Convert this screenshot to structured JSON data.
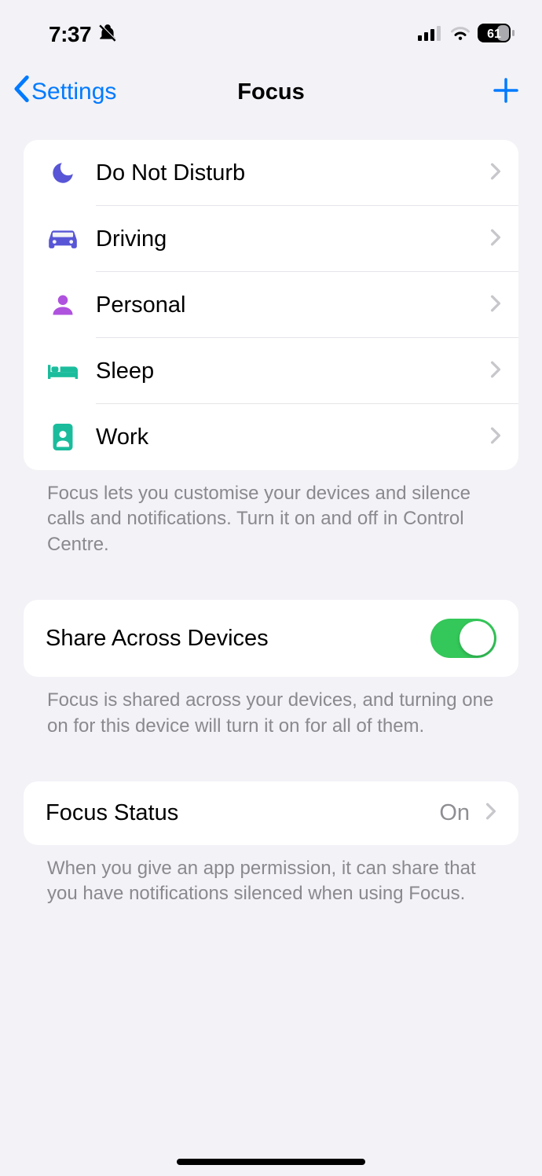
{
  "status": {
    "time": "7:37",
    "battery": "61"
  },
  "nav": {
    "back": "Settings",
    "title": "Focus"
  },
  "focusModes": [
    {
      "label": "Do Not Disturb",
      "icon": "moon",
      "color": "#5856d6"
    },
    {
      "label": "Driving",
      "icon": "car",
      "color": "#5856d6"
    },
    {
      "label": "Personal",
      "icon": "person",
      "color": "#af52de"
    },
    {
      "label": "Sleep",
      "icon": "bed",
      "color": "#1abc9c"
    },
    {
      "label": "Work",
      "icon": "badge",
      "color": "#1abc9c"
    }
  ],
  "footers": {
    "focus": "Focus lets you customise your devices and silence calls and notifications. Turn it on and off in Control Centre.",
    "share": "Focus is shared across your devices, and turning one on for this device will turn it on for all of them.",
    "status": "When you give an app permission, it can share that you have notifications silenced when using Focus."
  },
  "share": {
    "label": "Share Across Devices",
    "enabled": true
  },
  "focusStatus": {
    "label": "Focus Status",
    "value": "On"
  }
}
